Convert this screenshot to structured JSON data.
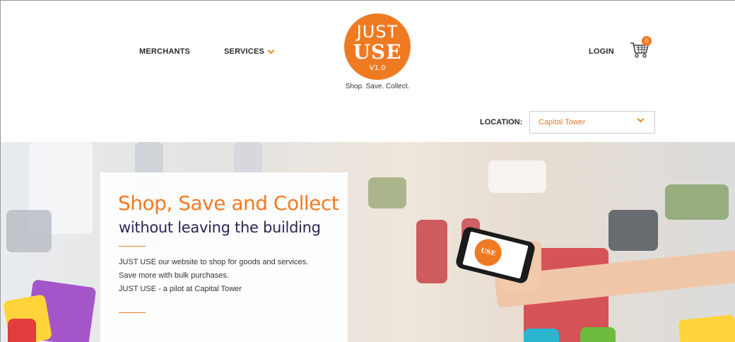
{
  "nav": {
    "merchants": "MERCHANTS",
    "services": "SERVICES",
    "login": "LOGIN"
  },
  "logo": {
    "line1": "JUST",
    "line2": "USE",
    "version": "V1.0",
    "tagline": "Shop. Save. Collect."
  },
  "cart": {
    "count": "0",
    "icon": "shopping-cart-icon"
  },
  "location": {
    "label": "LOCATION:",
    "selected": "Capital Tower"
  },
  "hero": {
    "title": "Shop, Save and Collect",
    "subtitle": "without leaving the building",
    "lines": [
      "JUST USE our website to shop for goods and services.",
      "Save more with bulk purchases.",
      "JUST USE - a pilot at Capital Tower"
    ]
  },
  "colors": {
    "accent": "#f07a22",
    "heading": "#2b2554"
  }
}
